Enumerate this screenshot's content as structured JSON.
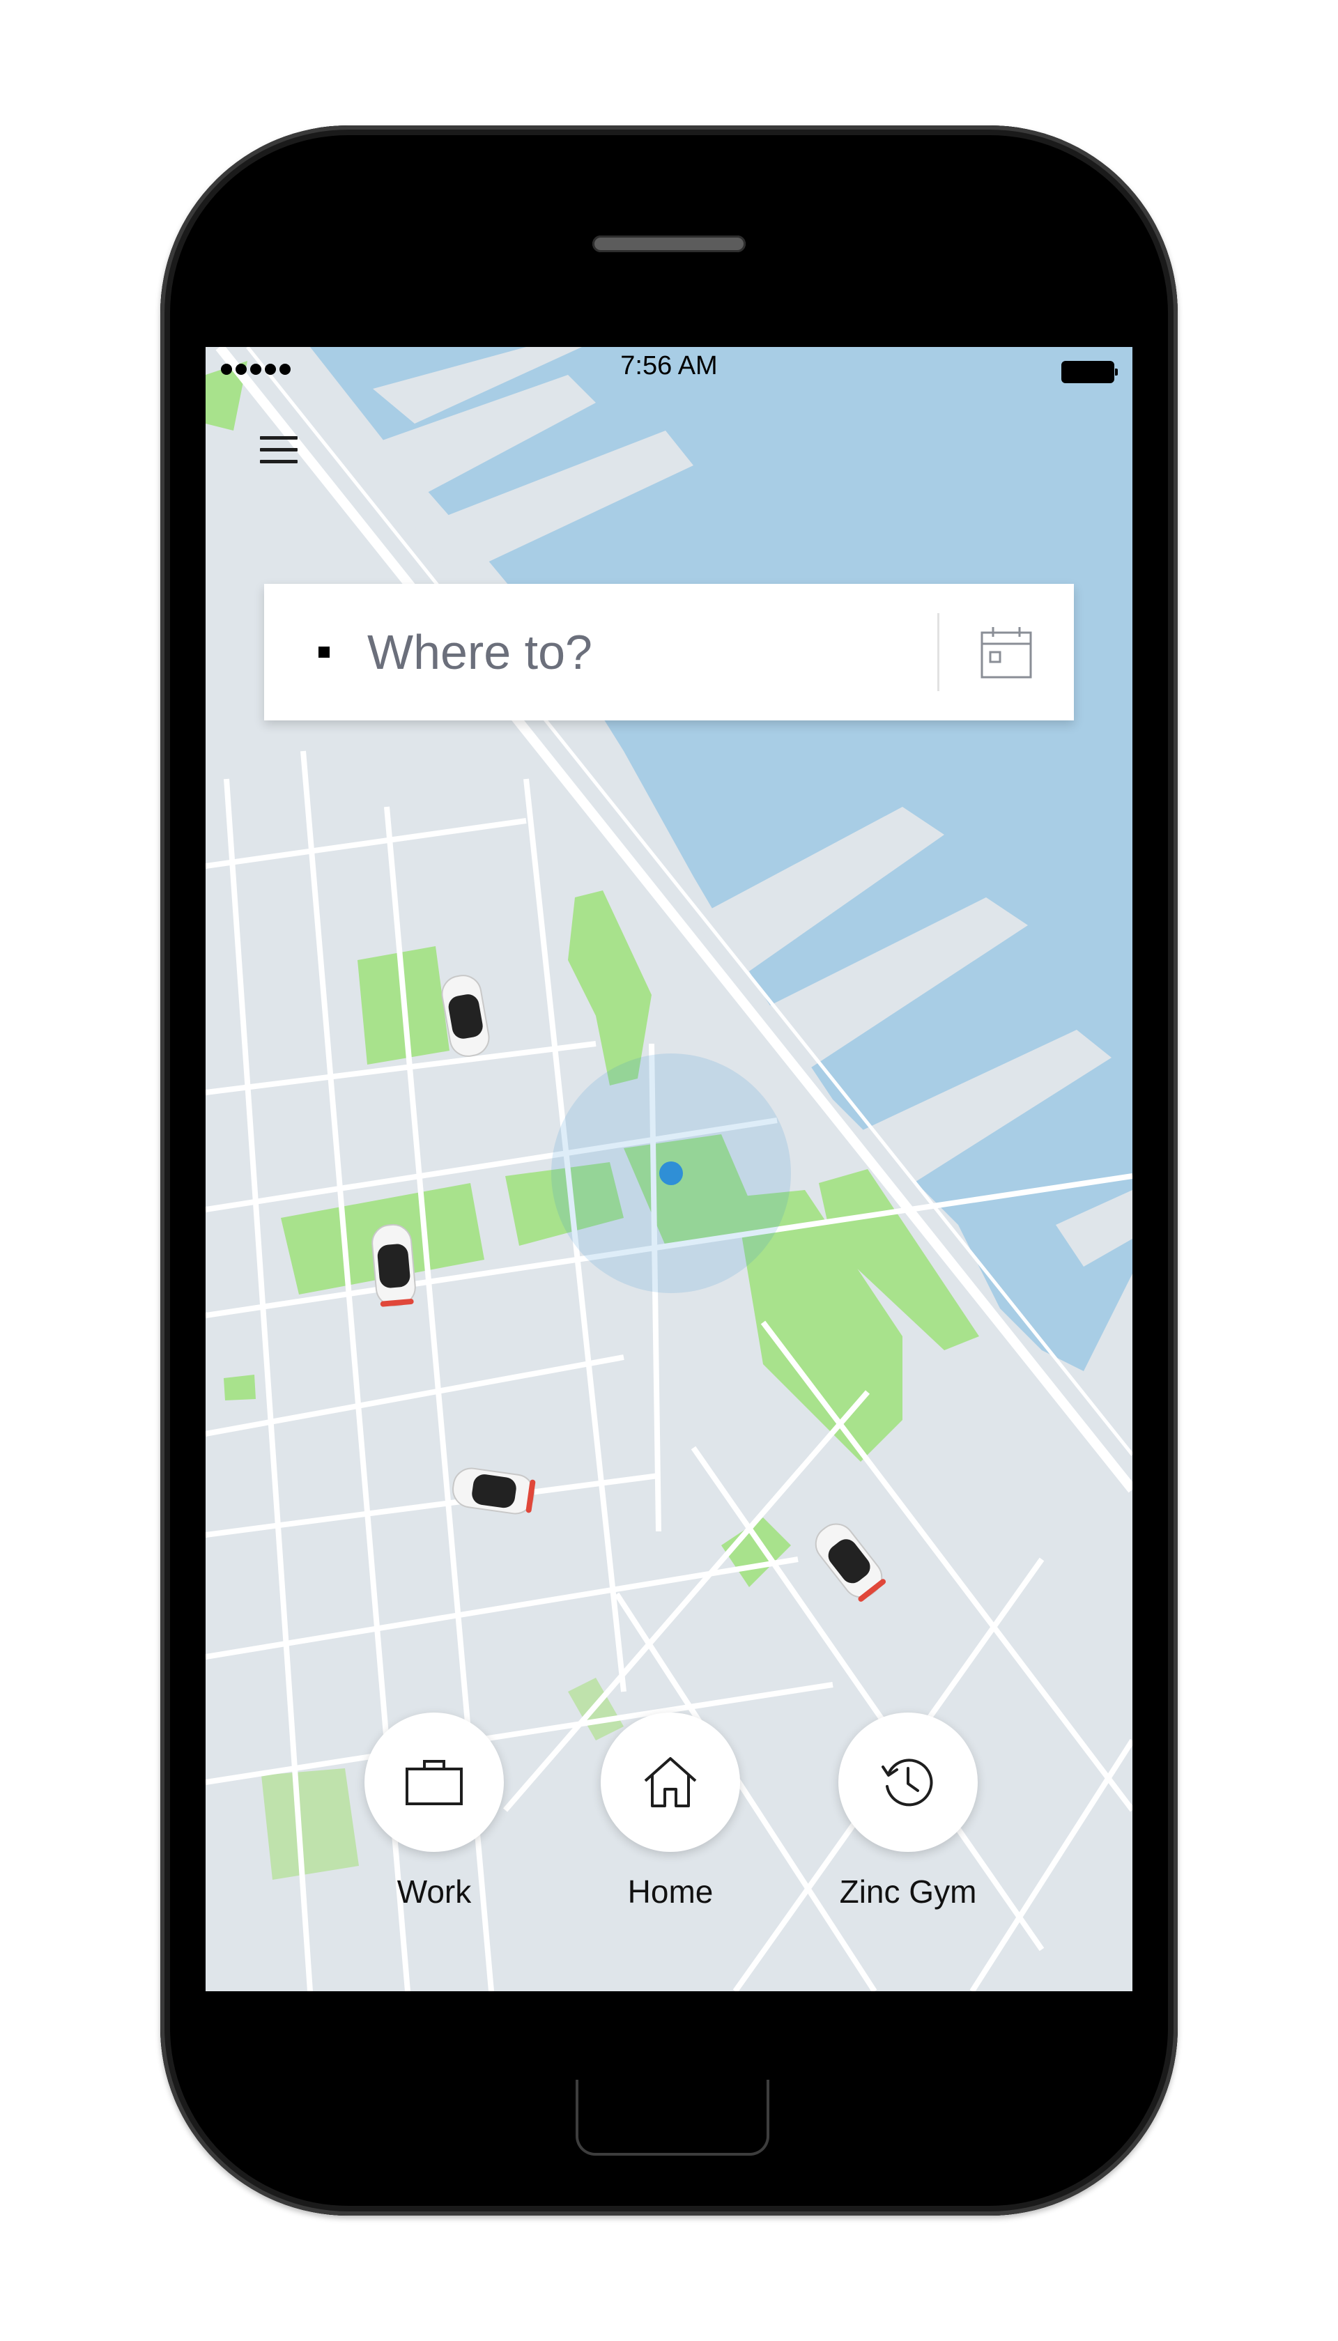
{
  "status_bar": {
    "time": "7:56 AM"
  },
  "search": {
    "placeholder": "Where to?"
  },
  "shortcuts": [
    {
      "label": "Work",
      "icon": "briefcase-icon"
    },
    {
      "label": "Home",
      "icon": "home-icon"
    },
    {
      "label": "Zinc Gym",
      "icon": "history-clock-icon"
    }
  ],
  "colors": {
    "water": "#a8cde5",
    "land": "#dfe5ea",
    "park": "#a8e28c",
    "road": "#ffffff",
    "location_dot": "#2f8fd6"
  }
}
